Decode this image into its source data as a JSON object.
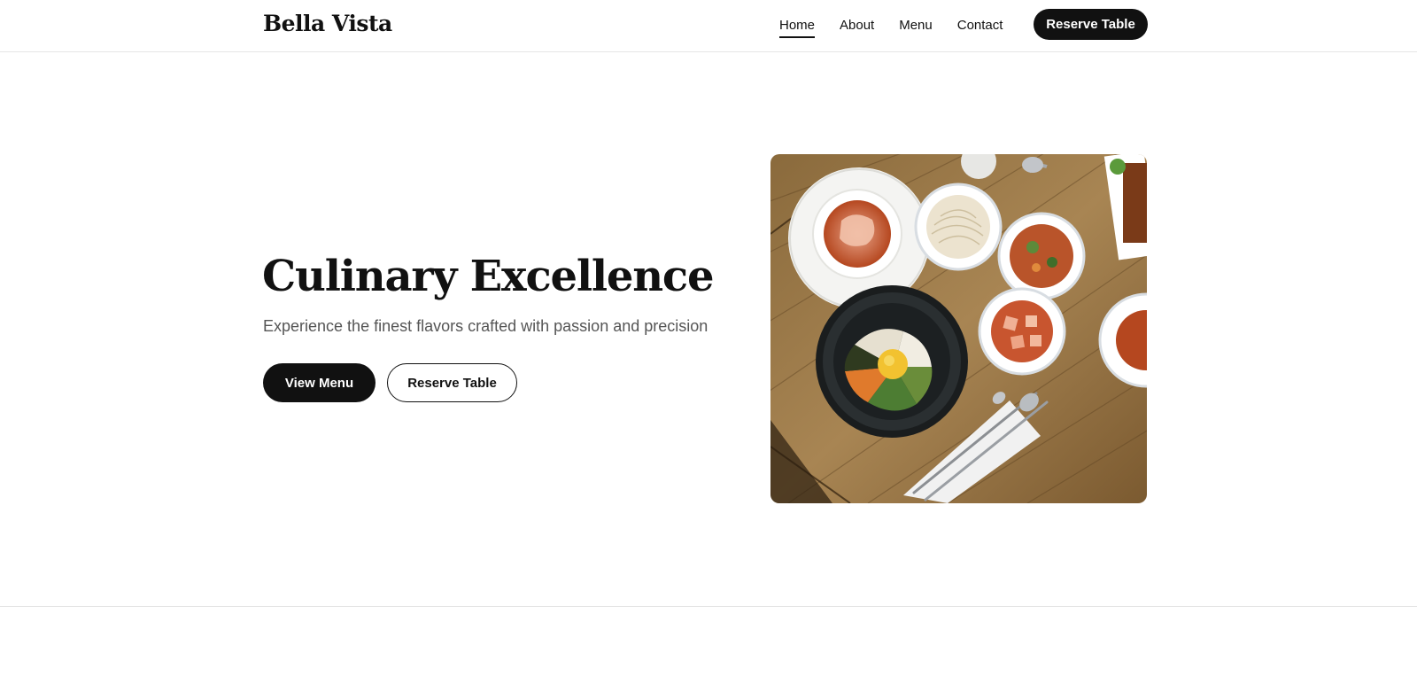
{
  "brand": {
    "name": "Bella Vista"
  },
  "nav": {
    "links": [
      {
        "label": "Home",
        "active": true
      },
      {
        "label": "About",
        "active": false
      },
      {
        "label": "Menu",
        "active": false
      },
      {
        "label": "Contact",
        "active": false
      }
    ],
    "cta_label": "Reserve Table"
  },
  "hero": {
    "title": "Culinary Excellence",
    "subtitle": "Experience the finest flavors crafted with passion and precision",
    "primary_button": "View Menu",
    "secondary_button": "Reserve Table",
    "image_icon": "food-photo-bibimbap-table"
  },
  "colors": {
    "primary": "#111111",
    "text_muted": "#555555",
    "border": "#e5e5e5",
    "background": "#ffffff"
  }
}
